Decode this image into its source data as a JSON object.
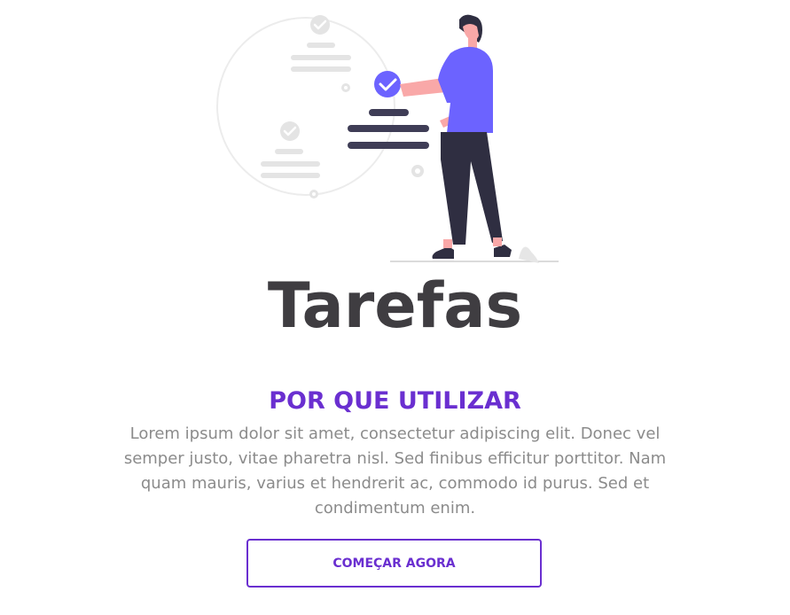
{
  "hero": {
    "title": "Tarefas",
    "accent_color": "#6c63ff",
    "ink_color": "#3f3d56"
  },
  "about": {
    "heading": "POR QUE UTILIZAR",
    "text": "Lorem ipsum dolor sit amet, consectetur adipiscing elit. Donec vel semper justo, vitae pharetra nisl. Sed finibus efficitur porttitor. Nam quam mauris, varius et hendrerit ac, commodo id purus. Sed et condimentum enim."
  },
  "cta": {
    "label": "COMEÇAR AGORA",
    "color": "#6a2fd0"
  }
}
